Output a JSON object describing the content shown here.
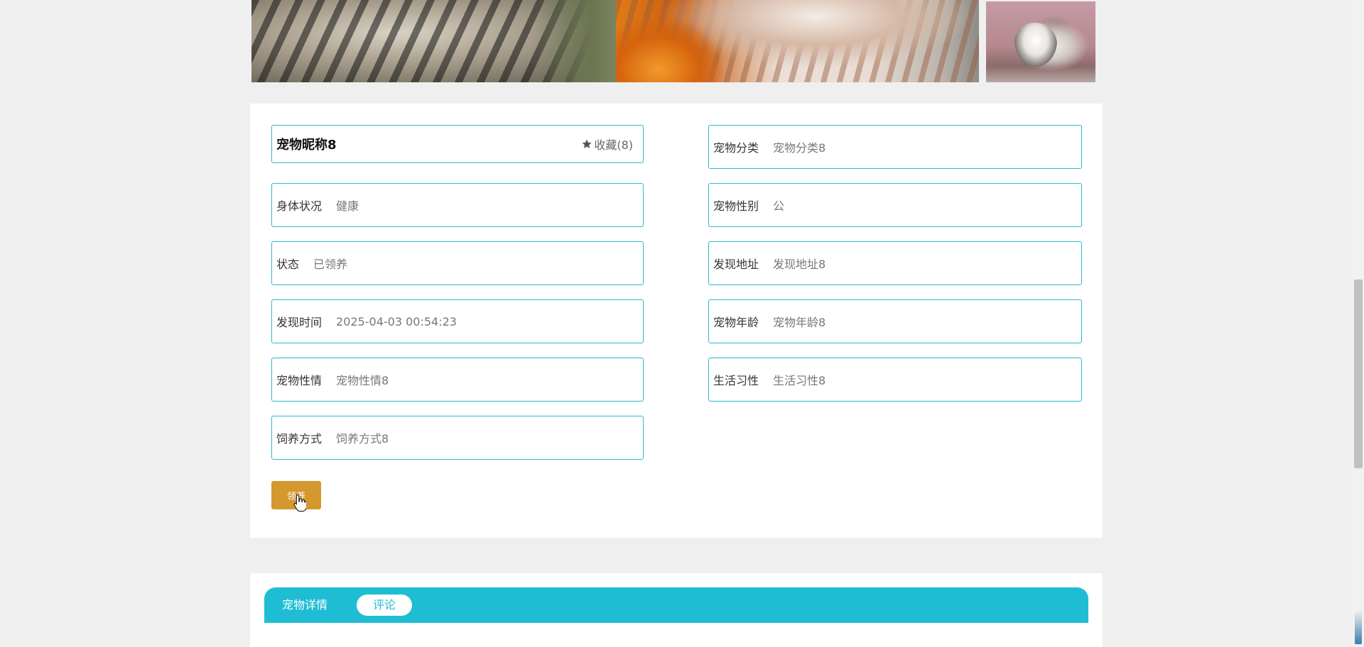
{
  "gallery": {
    "images": [
      {
        "alt": "tabby-cat-photo"
      },
      {
        "alt": "orange-white-cat-photo"
      },
      {
        "alt": "grey-white-cat-photo"
      }
    ]
  },
  "pet": {
    "name": "宠物昵称8",
    "favorite_label": "收藏(8)",
    "fields_left": [
      {
        "label": "身体状况",
        "value": "健康"
      },
      {
        "label": "状态",
        "value": "已领养"
      },
      {
        "label": "发现时间",
        "value": "2025-04-03 00:54:23"
      },
      {
        "label": "宠物性情",
        "value": "宠物性情8"
      },
      {
        "label": "饲养方式",
        "value": "饲养方式8"
      }
    ],
    "fields_right": [
      {
        "label": "宠物分类",
        "value": "宠物分类8"
      },
      {
        "label": "宠物性别",
        "value": "公"
      },
      {
        "label": "发现地址",
        "value": "发现地址8"
      },
      {
        "label": "宠物年龄",
        "value": "宠物年龄8"
      },
      {
        "label": "生活习性",
        "value": "生活习性8"
      }
    ],
    "adopt_button": "领养"
  },
  "tabs": [
    {
      "label": "宠物详情",
      "active": false
    },
    {
      "label": "评论",
      "active": true
    }
  ],
  "colors": {
    "accent": "#2cb9cf",
    "tab_bar": "#1ebdd4",
    "adopt_button": "#d4982f",
    "page_background": "#efefef"
  },
  "icons": {
    "favorite": "star-icon",
    "cursor": "hand-pointer-icon"
  }
}
